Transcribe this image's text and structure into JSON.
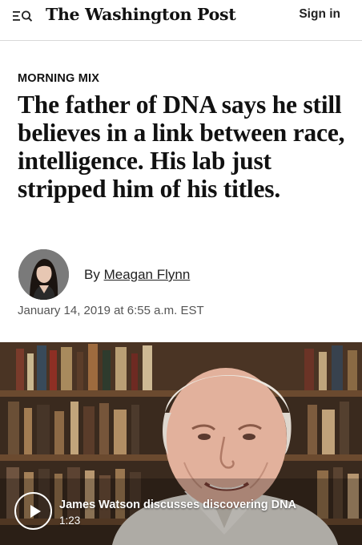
{
  "header": {
    "masthead": "The Washington Post",
    "signin_label": "Sign in"
  },
  "article": {
    "kicker": "MORNING MIX",
    "headline": "The father of DNA says he still believes in a link between race, intelligence. His lab just stripped him of his titles.",
    "byline_prefix": "By",
    "author": "Meagan Flynn",
    "date": "January 14, 2019 at 6:55 a.m. EST"
  },
  "video": {
    "title": "James Watson discusses discovering DNA",
    "duration": "1:23"
  },
  "icons": {
    "menu": "hamburger-menu-icon",
    "search": "search-icon",
    "play": "play-icon"
  },
  "colors": {
    "text": "#111111",
    "meta": "#555555",
    "divider": "#d9d9d9"
  }
}
